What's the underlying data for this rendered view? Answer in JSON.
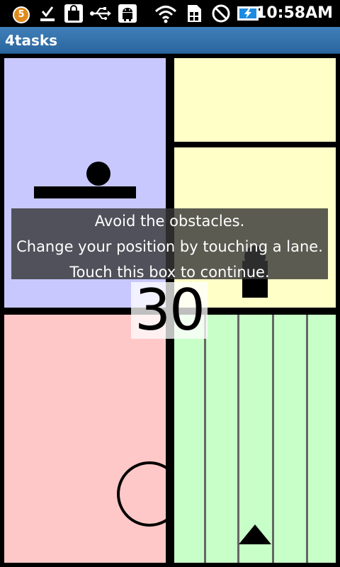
{
  "status_bar": {
    "notification_count": "5",
    "time": "10:58AM",
    "icons": [
      "notification-badge-icon",
      "checkmark-icon",
      "bag-icon",
      "usb-icon",
      "android-icon",
      "wifi-icon",
      "sim-icon",
      "no-sound-icon",
      "battery-charging-icon"
    ]
  },
  "app": {
    "title": "4tasks"
  },
  "overlay": {
    "line1": "Avoid the obstacles.",
    "line2": "Change your position by touching a lane.",
    "line3": "Touch this box to continue."
  },
  "countdown": "30",
  "colors": {
    "panel_top_left": "#c8c8ff",
    "panel_top_right": "#ffffc8",
    "panel_bottom_left": "#ffc8c8",
    "panel_bottom_right": "#c8ffc8",
    "title_bar": "#2f6ea8"
  }
}
